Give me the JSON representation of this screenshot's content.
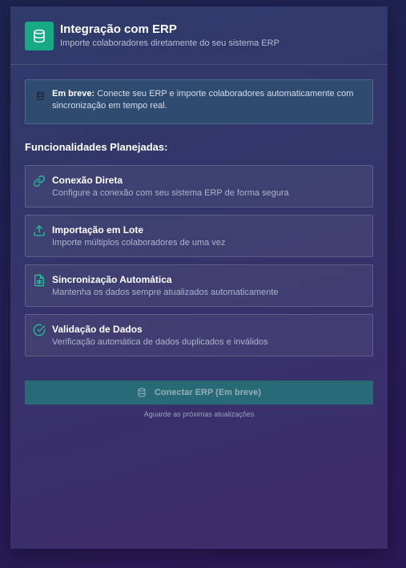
{
  "header": {
    "icon": "database-icon",
    "title": "Integração com ERP",
    "subtitle": "Importe colaboradores diretamente do seu sistema ERP"
  },
  "notice": {
    "icon": "database-icon",
    "bold": "Em breve:",
    "text": "Conecte seu ERP e importe colaboradores automaticamente com sincronização em tempo real."
  },
  "features_title": "Funcionalidades Planejadas:",
  "features": [
    {
      "icon": "link-icon",
      "title": "Conexão Direta",
      "description": "Configure a conexão com seu sistema ERP de forma segura"
    },
    {
      "icon": "upload-icon",
      "title": "Importação em Lote",
      "description": "Importe múltiplos colaboradores de uma vez"
    },
    {
      "icon": "sheet-icon",
      "title": "Sincronização Automática",
      "description": "Mantenha os dados sempre atualizados automaticamente"
    },
    {
      "icon": "check-circle-icon",
      "title": "Validação de Dados",
      "description": "Verificação automática de dados duplicados e inválidos"
    }
  ],
  "connect_button": {
    "icon": "database-icon",
    "label": "Conectar ERP (Em breve)"
  },
  "hint": "Aguarde as próximas atualizações",
  "colors": {
    "accent": "#16a983",
    "feature_icon": "#22c39a",
    "button": "#286a76"
  }
}
